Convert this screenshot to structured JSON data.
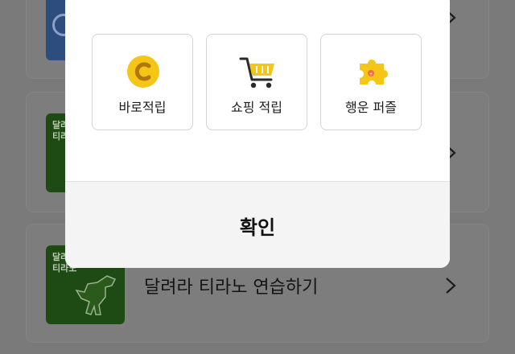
{
  "background": {
    "cards": [
      {
        "thumb_text": ""
      },
      {
        "thumb_text": "달려\n티라"
      },
      {
        "thumb_text": "달려\n티라노",
        "title": "달려라 티라노 연습하기"
      }
    ],
    "chevron": "›"
  },
  "modal": {
    "options": [
      {
        "label": "바로적립",
        "icon": "coin-icon"
      },
      {
        "label": "쇼핑 적립",
        "icon": "shopping-cart-icon"
      },
      {
        "label": "행운 퍼즐",
        "icon": "puzzle-piece-icon"
      }
    ],
    "confirm_label": "확인"
  },
  "colors": {
    "accent_yellow": "#f5c518",
    "dim_overlay": "#7a7a7a"
  }
}
